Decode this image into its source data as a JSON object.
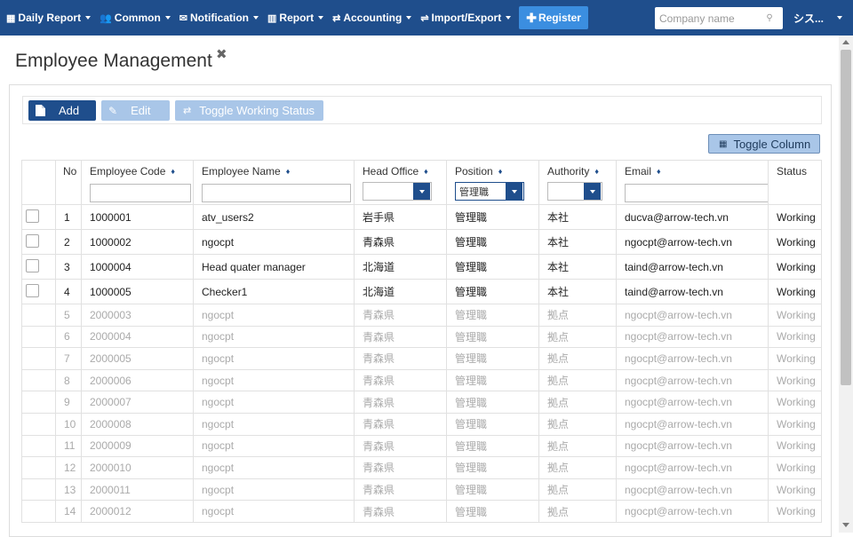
{
  "nav": {
    "items": [
      {
        "icon": "calendar-icon",
        "glyph": "▦",
        "label": "Daily Report"
      },
      {
        "icon": "users-icon",
        "glyph": "👥",
        "label": "Common"
      },
      {
        "icon": "envelope-icon",
        "glyph": "✉",
        "label": "Notification"
      },
      {
        "icon": "chart-icon",
        "glyph": "▥",
        "label": "Report"
      },
      {
        "icon": "exchange-icon",
        "glyph": "⇄",
        "label": "Accounting"
      },
      {
        "icon": "swap-icon",
        "glyph": "⇌",
        "label": "Import/Export"
      }
    ],
    "register_label": "Register",
    "company_placeholder": "Company name",
    "user_label": "シス..."
  },
  "page": {
    "title": "Employee Management",
    "close_glyph": "✖"
  },
  "toolbar": {
    "add_label": "Add",
    "edit_label": "Edit",
    "toggle_status_label": "Toggle Working Status",
    "toggle_column_label": "Toggle Column"
  },
  "table": {
    "headers": {
      "no": "No",
      "code": "Employee Code",
      "name": "Employee Name",
      "office": "Head Office",
      "position": "Position",
      "authority": "Authority",
      "email": "Email",
      "status": "Status"
    },
    "filters": {
      "code": "",
      "name": "",
      "office": "",
      "position": "管理職",
      "authority": "",
      "email": ""
    },
    "rows": [
      {
        "no": "1",
        "code": "1000001",
        "name": "atv_users2",
        "office": "岩手県",
        "position": "管理職",
        "authority": "本社",
        "email": "ducva@arrow-tech.vn",
        "status": "Working",
        "enabled": true
      },
      {
        "no": "2",
        "code": "1000002",
        "name": "ngocpt",
        "office": "青森県",
        "position": "管理職",
        "authority": "本社",
        "email": "ngocpt@arrow-tech.vn",
        "status": "Working",
        "enabled": true
      },
      {
        "no": "3",
        "code": "1000004",
        "name": "Head quater manager",
        "office": "北海道",
        "position": "管理職",
        "authority": "本社",
        "email": "taind@arrow-tech.vn",
        "status": "Working",
        "enabled": true
      },
      {
        "no": "4",
        "code": "1000005",
        "name": "Checker1",
        "office": "北海道",
        "position": "管理職",
        "authority": "本社",
        "email": "taind@arrow-tech.vn",
        "status": "Working",
        "enabled": true
      },
      {
        "no": "5",
        "code": "2000003",
        "name": "ngocpt",
        "office": "青森県",
        "position": "管理職",
        "authority": "拠点",
        "email": "ngocpt@arrow-tech.vn",
        "status": "Working",
        "enabled": false
      },
      {
        "no": "6",
        "code": "2000004",
        "name": "ngocpt",
        "office": "青森県",
        "position": "管理職",
        "authority": "拠点",
        "email": "ngocpt@arrow-tech.vn",
        "status": "Working",
        "enabled": false
      },
      {
        "no": "7",
        "code": "2000005",
        "name": "ngocpt",
        "office": "青森県",
        "position": "管理職",
        "authority": "拠点",
        "email": "ngocpt@arrow-tech.vn",
        "status": "Working",
        "enabled": false
      },
      {
        "no": "8",
        "code": "2000006",
        "name": "ngocpt",
        "office": "青森県",
        "position": "管理職",
        "authority": "拠点",
        "email": "ngocpt@arrow-tech.vn",
        "status": "Working",
        "enabled": false
      },
      {
        "no": "9",
        "code": "2000007",
        "name": "ngocpt",
        "office": "青森県",
        "position": "管理職",
        "authority": "拠点",
        "email": "ngocpt@arrow-tech.vn",
        "status": "Working",
        "enabled": false
      },
      {
        "no": "10",
        "code": "2000008",
        "name": "ngocpt",
        "office": "青森県",
        "position": "管理職",
        "authority": "拠点",
        "email": "ngocpt@arrow-tech.vn",
        "status": "Working",
        "enabled": false
      },
      {
        "no": "11",
        "code": "2000009",
        "name": "ngocpt",
        "office": "青森県",
        "position": "管理職",
        "authority": "拠点",
        "email": "ngocpt@arrow-tech.vn",
        "status": "Working",
        "enabled": false
      },
      {
        "no": "12",
        "code": "2000010",
        "name": "ngocpt",
        "office": "青森県",
        "position": "管理職",
        "authority": "拠点",
        "email": "ngocpt@arrow-tech.vn",
        "status": "Working",
        "enabled": false
      },
      {
        "no": "13",
        "code": "2000011",
        "name": "ngocpt",
        "office": "青森県",
        "position": "管理職",
        "authority": "拠点",
        "email": "ngocpt@arrow-tech.vn",
        "status": "Working",
        "enabled": false
      },
      {
        "no": "14",
        "code": "2000012",
        "name": "ngocpt",
        "office": "青森県",
        "position": "管理職",
        "authority": "拠点",
        "email": "ngocpt@arrow-tech.vn",
        "status": "Working",
        "enabled": false
      }
    ]
  },
  "colors": {
    "nav_bg": "#1f4e8c",
    "primary": "#1f4e8c",
    "disabled_btn": "#a9c6e8",
    "register": "#3b8ee0"
  }
}
